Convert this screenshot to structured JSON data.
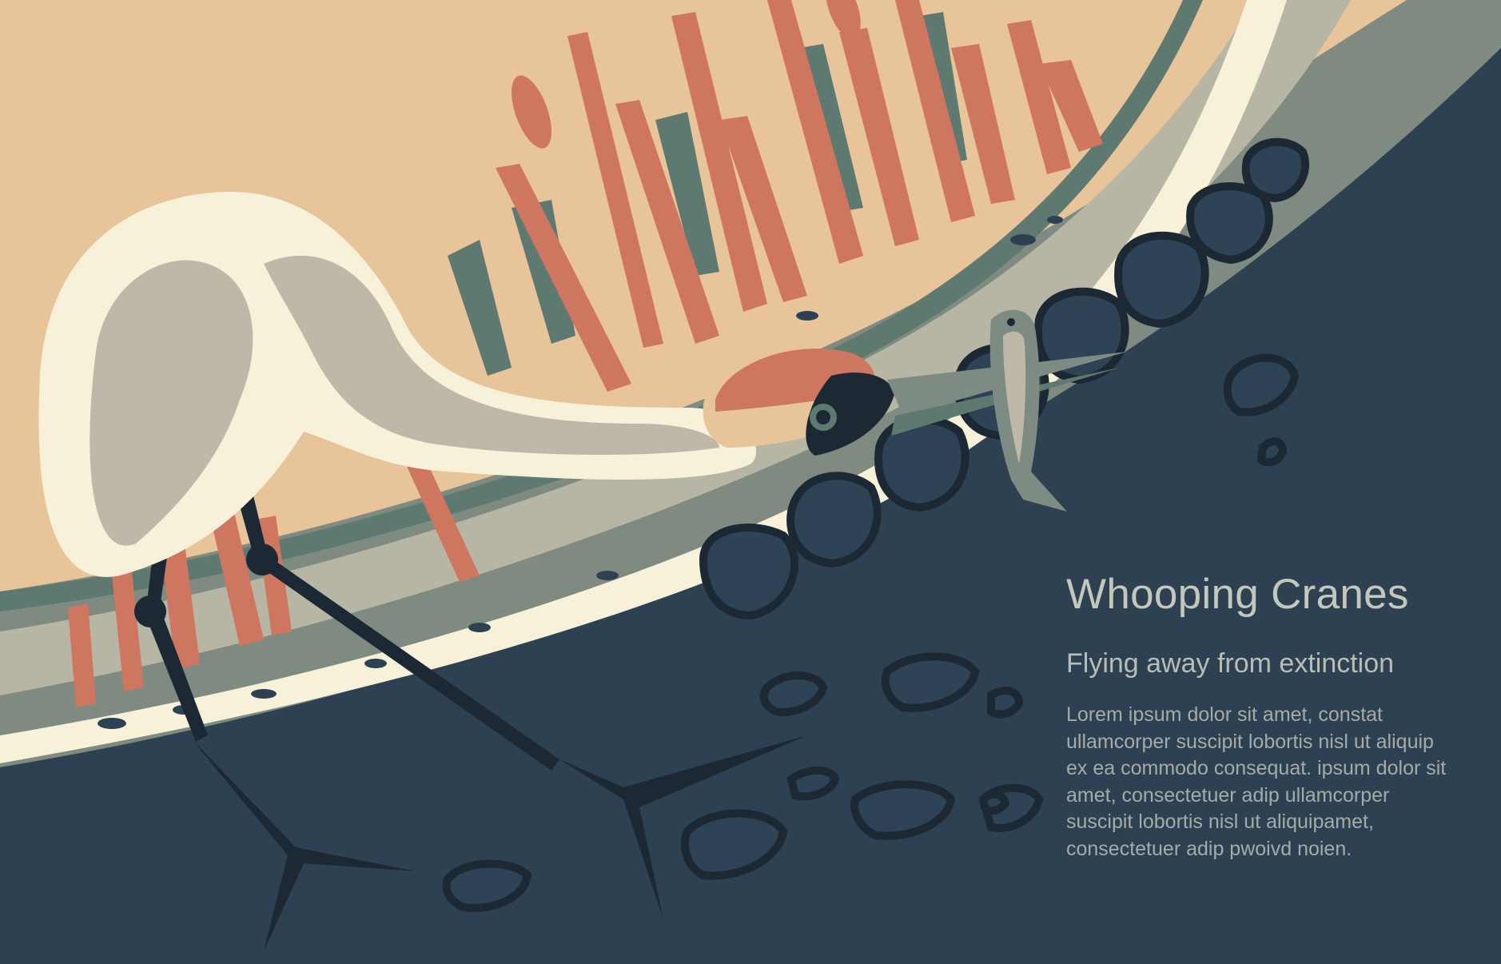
{
  "poster": {
    "title": "Whooping Cranes",
    "subtitle": "Flying away from extinction",
    "body": "Lorem ipsum dolor sit amet, constat ullamcorper suscipit lobortis nisl ut aliquip ex ea commodo consequat. ipsum dolor sit amet, consectetuer adip ullamcorper suscipit lobortis nisl ut aliquipamet, consectetuer adip pwoivd noien."
  },
  "palette": {
    "sky": "#e8c49b",
    "reeds": "#cf7660",
    "water": "#2d4152",
    "shore_gray": "#7f8a80",
    "shore_light": "#b7b5a4",
    "foam": "#f6f1d8",
    "crane_white": "#f6f1d8",
    "crane_shade": "#bdb8a8",
    "crown_red": "#cf7660",
    "legs": "#1c2934",
    "fish": "#7e8b83",
    "title_text": "#c3c7bc",
    "body_text": "#a5aca7"
  },
  "icons": [
    "whooping-crane-illustration",
    "fish-icon",
    "reed-icon",
    "rock-icon"
  ]
}
